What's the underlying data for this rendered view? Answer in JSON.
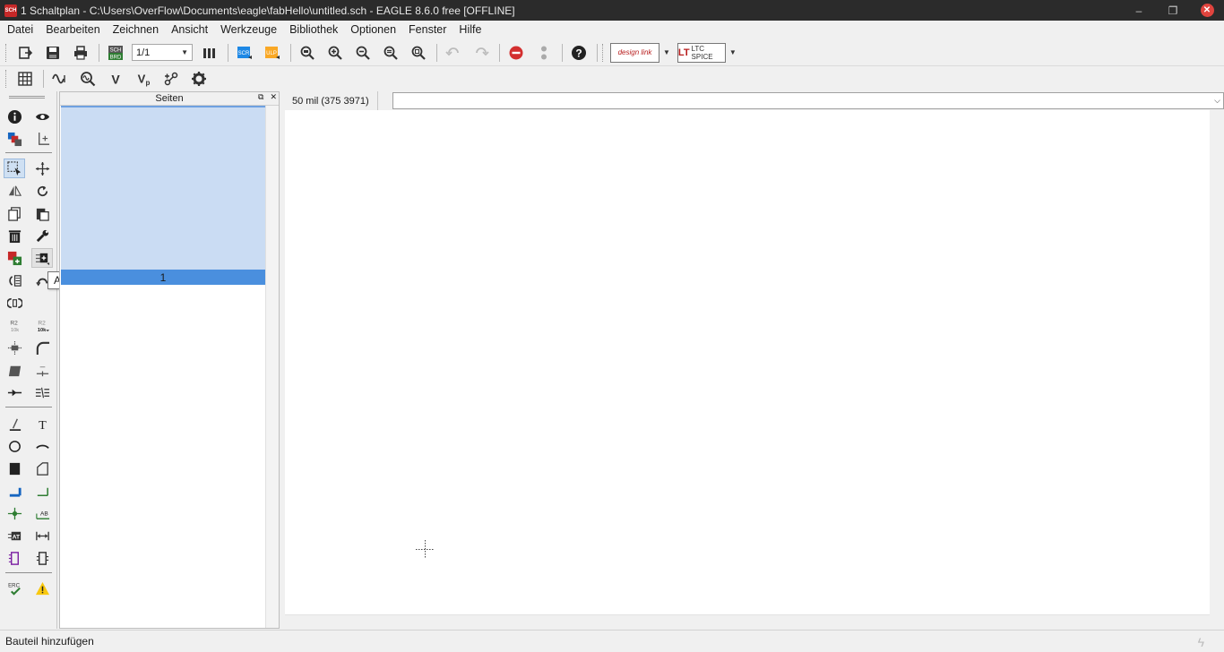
{
  "window": {
    "title": "1 Schaltplan - C:\\Users\\OverFlow\\Documents\\eagle\\fabHello\\untitled.sch - EAGLE 8.6.0 free [OFFLINE]",
    "app_icon_text": "SCH",
    "minimize": "–",
    "restore": "❐",
    "close": "✕"
  },
  "menu": [
    "Datei",
    "Bearbeiten",
    "Zeichnen",
    "Ansicht",
    "Werkzeuge",
    "Bibliothek",
    "Optionen",
    "Fenster",
    "Hilfe"
  ],
  "toolbar": {
    "sheet_select": "1/1",
    "design_link_label": "design link",
    "ltc_logo": "LT",
    "ltc_label": "LTC SPICE",
    "scr_label": "SCR",
    "ulp_label": "ULP",
    "brd_label": "SCH BRD"
  },
  "sheets_panel": {
    "title": "Seiten",
    "selected_sheet": "1"
  },
  "tooltip": "Add",
  "coordinates": "50 mil (375 3971)",
  "command_line": "",
  "status": "Bauteil hinzufügen",
  "colors": {
    "titlebar": "#2b2b2b",
    "selection": "#4a8fde",
    "preview": "#cadcf3",
    "accent_red": "#c62828",
    "accent_blue": "#1565c0"
  }
}
